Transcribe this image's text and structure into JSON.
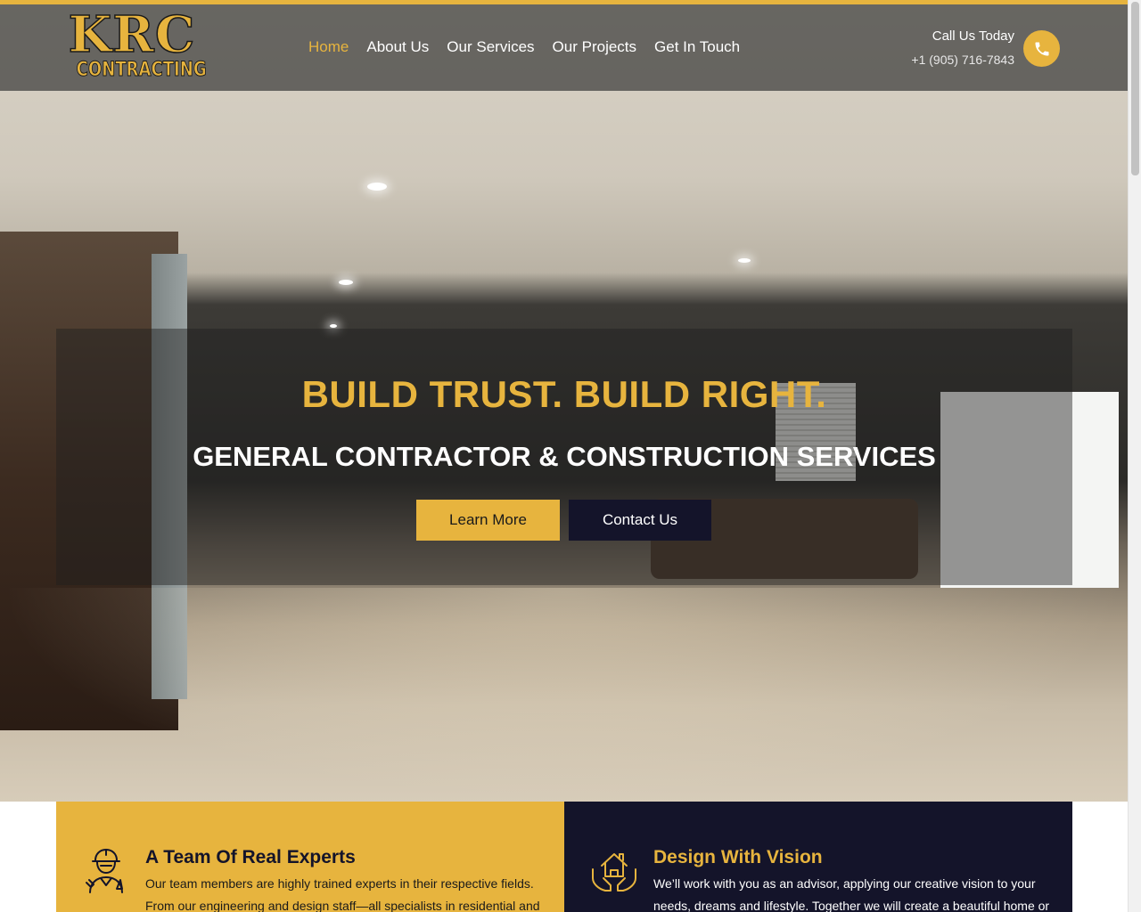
{
  "brand": {
    "logo_main": "KRC",
    "logo_sub": "CONTRACTING",
    "accent_color": "#e7b43e",
    "dark_color": "#14142a"
  },
  "nav": {
    "items": [
      {
        "label": "Home",
        "active": true
      },
      {
        "label": "About Us",
        "active": false
      },
      {
        "label": "Our Services",
        "active": false
      },
      {
        "label": "Our Projects",
        "active": false
      },
      {
        "label": "Get In Touch",
        "active": false
      }
    ]
  },
  "call": {
    "title": "Call Us Today",
    "phone": "+1 (905) 716-7843",
    "icon": "phone-icon"
  },
  "hero": {
    "title": "BUILD TRUST. BUILD RIGHT.",
    "subtitle": "GENERAL CONTRACTOR & CONSTRUCTION SERVICES",
    "learn_more": "Learn More",
    "contact_us": "Contact Us"
  },
  "features": [
    {
      "title": "A Team Of Real Experts",
      "text": "Our team members are highly trained experts in their respective fields. From our engineering and design staff—all specialists in residential and",
      "icon": "engineer-icon"
    },
    {
      "title": "Design With Vision",
      "text": "We’ll work with you as an advisor, applying our creative vision to your needs, dreams and lifestyle. Together we will create a beautiful home or",
      "icon": "house-in-hands-icon"
    }
  ]
}
